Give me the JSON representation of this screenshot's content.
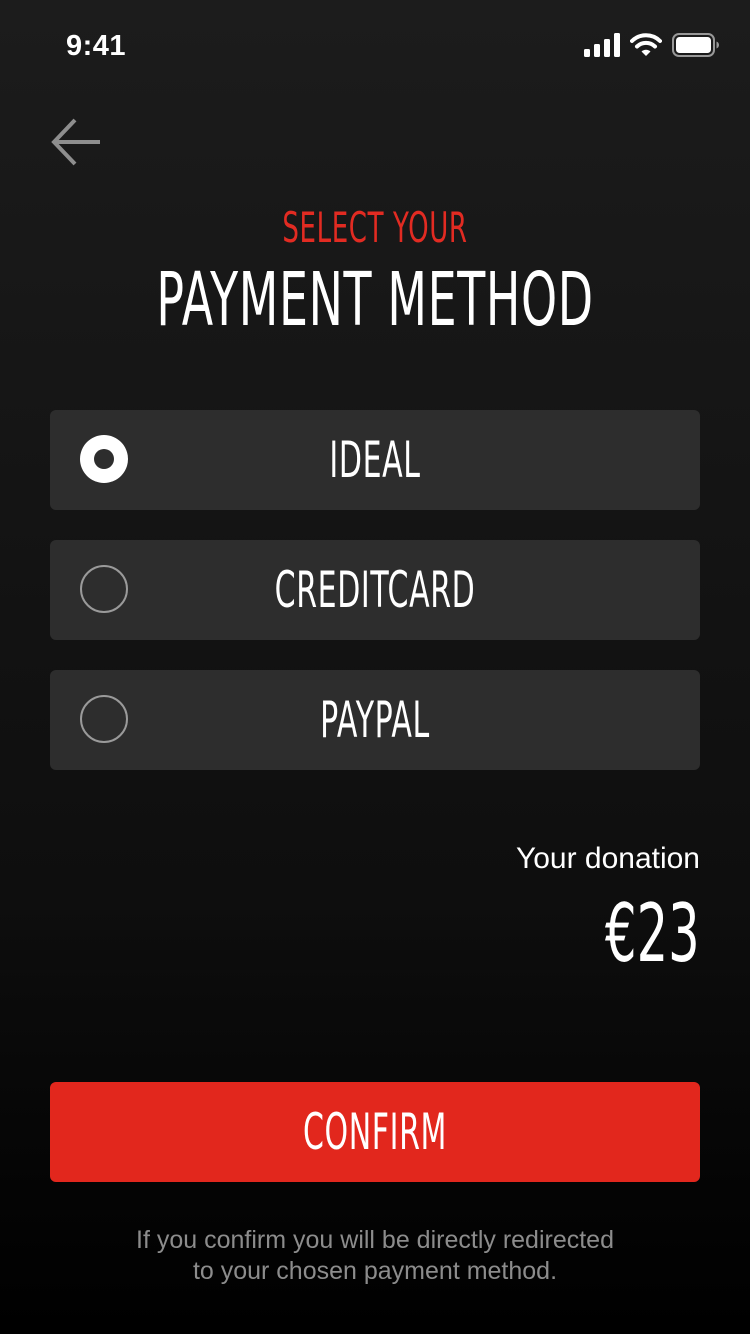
{
  "status_bar": {
    "time": "9:41",
    "icons": [
      "signal-icon",
      "wifi-icon",
      "battery-icon"
    ]
  },
  "nav": {
    "back_icon": "arrow-left-icon"
  },
  "heading": {
    "sub": "SELECT YOUR",
    "main": "PAYMENT METHOD"
  },
  "payment_options": [
    {
      "label": "IDEAL",
      "selected": true
    },
    {
      "label": "CREDITCARD",
      "selected": false
    },
    {
      "label": "PAYPAL",
      "selected": false
    }
  ],
  "donation": {
    "label": "Your donation",
    "amount": "€23"
  },
  "confirm": {
    "label": "CONFIRM"
  },
  "footnote": {
    "line1": "If you confirm you will be directly redirected",
    "line2": "to your chosen payment method."
  },
  "colors": {
    "accent": "#e2271d",
    "option_background": "#2d2d2d",
    "background": "#141414",
    "muted_text": "#8c8c8c"
  }
}
